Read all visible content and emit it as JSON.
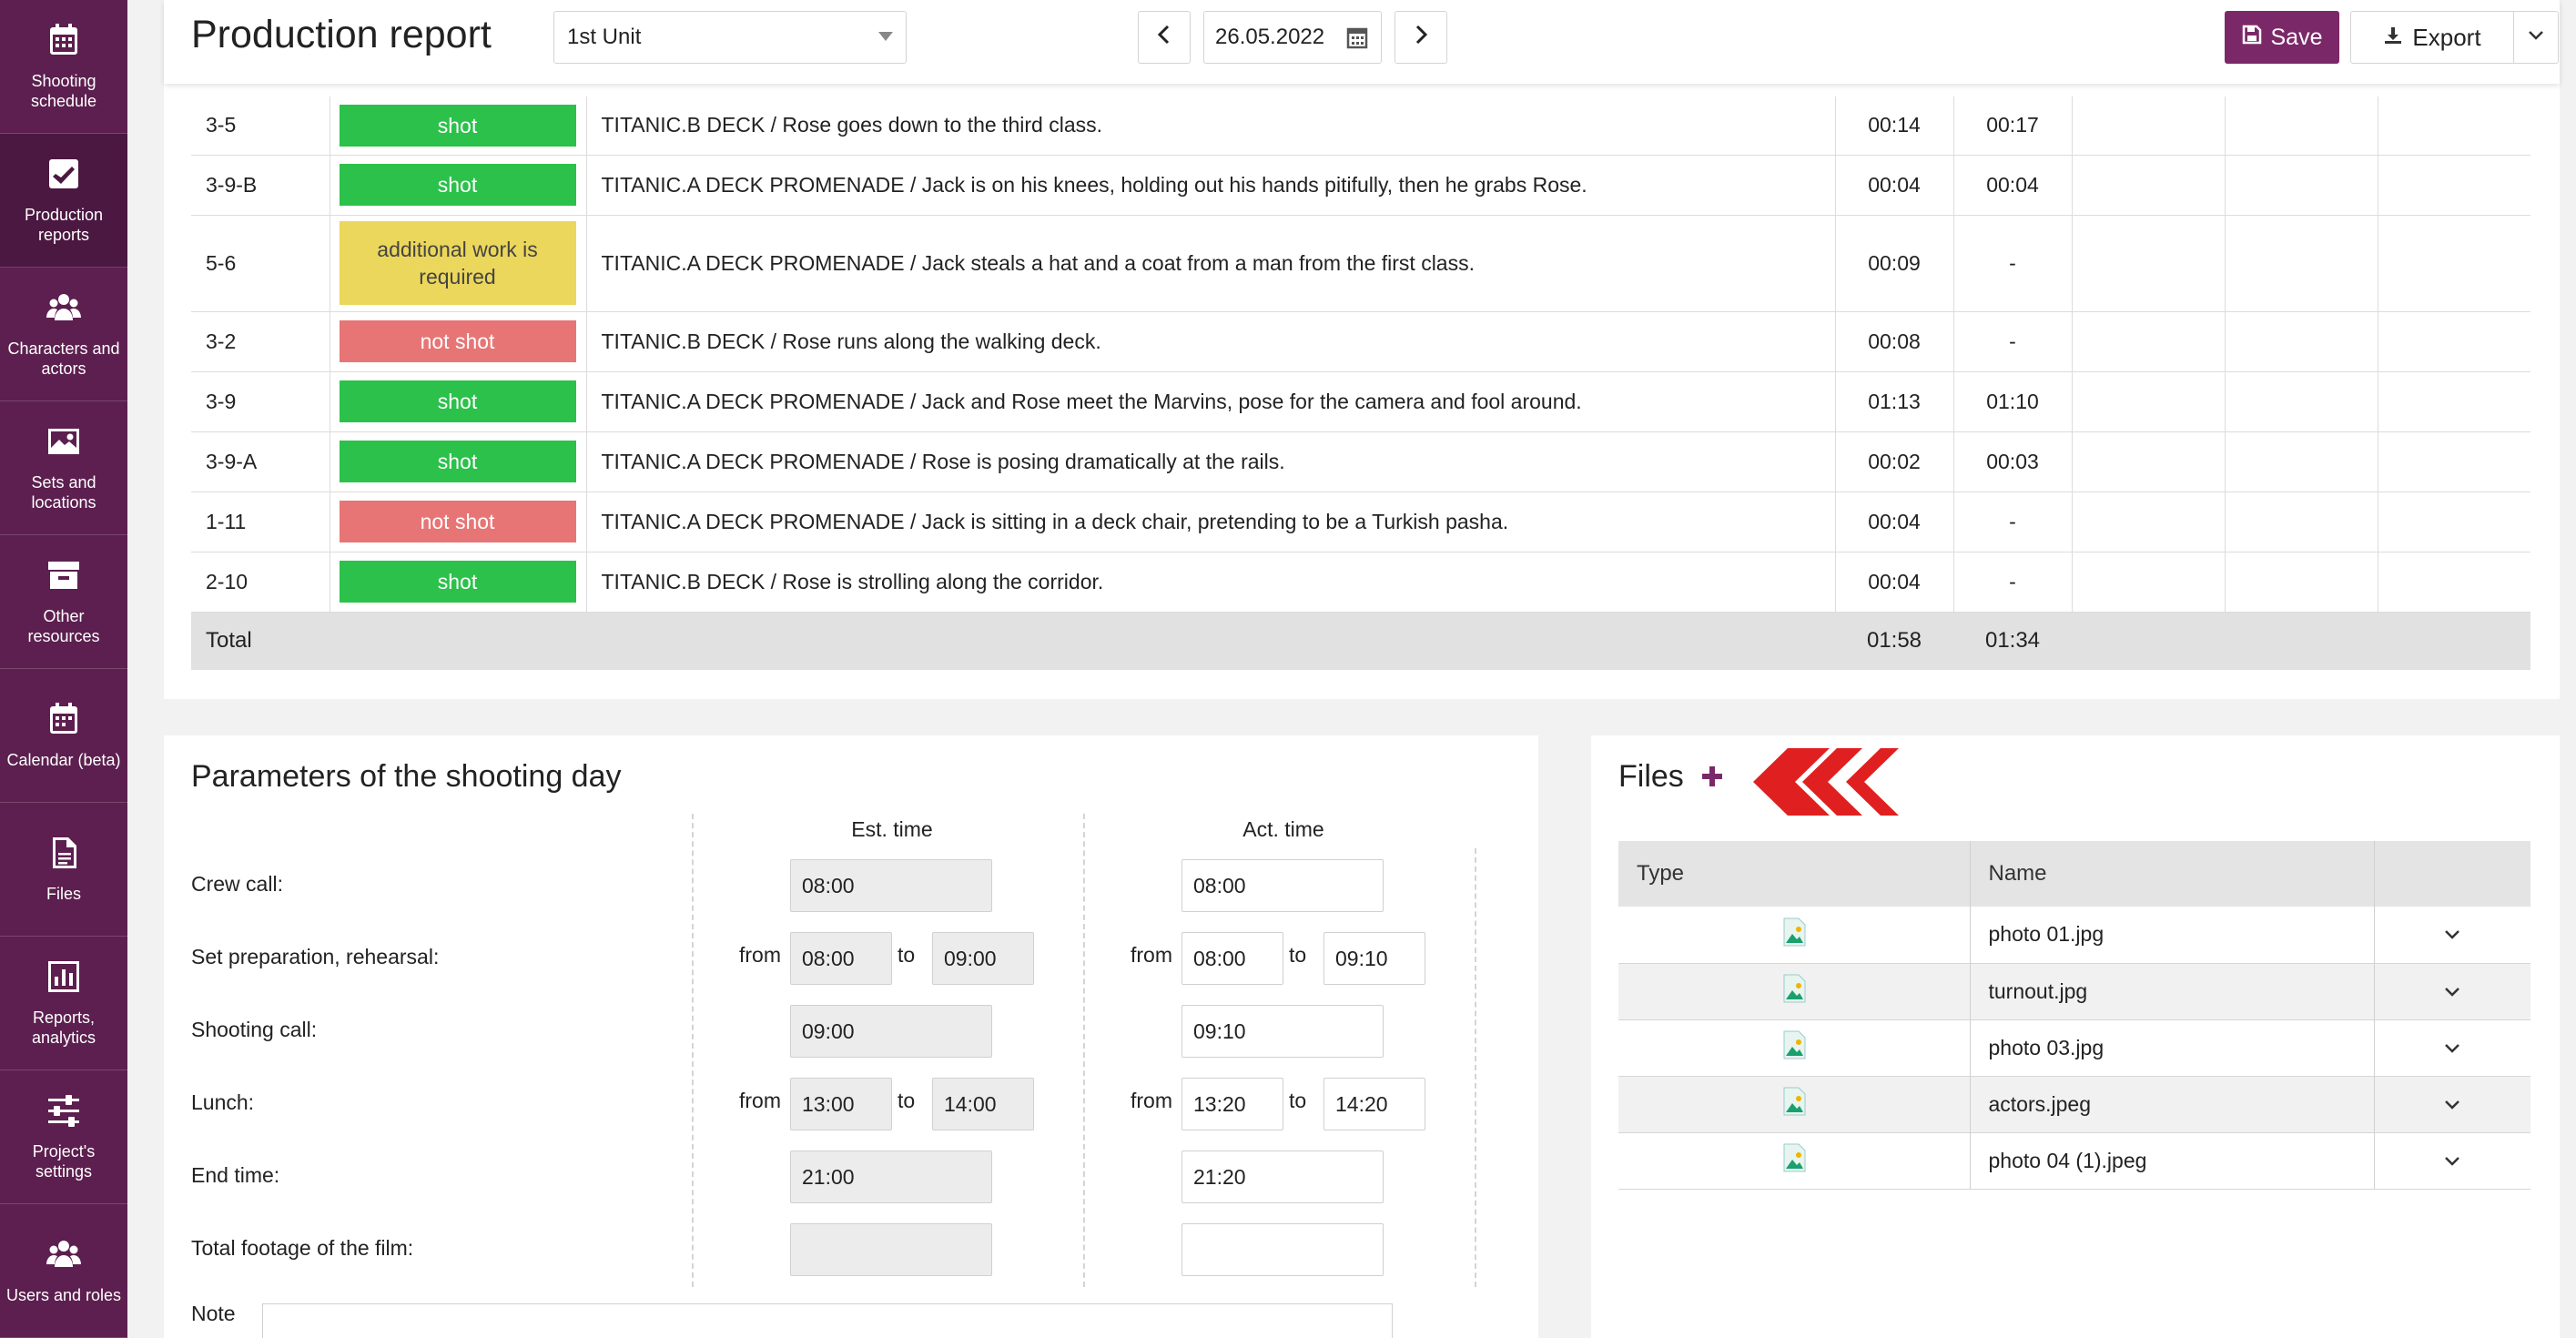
{
  "sidebar": {
    "items": [
      {
        "label": "Shooting schedule",
        "icon": "calendar-grid-icon"
      },
      {
        "label": "Production reports",
        "icon": "checkbox-icon"
      },
      {
        "label": "Characters and actors",
        "icon": "people-icon"
      },
      {
        "label": "Sets and locations",
        "icon": "image-icon"
      },
      {
        "label": "Other resources",
        "icon": "archive-box-icon"
      },
      {
        "label": "Calendar (beta)",
        "icon": "calendar-icon"
      },
      {
        "label": "Files",
        "icon": "document-icon"
      },
      {
        "label": "Reports, analytics",
        "icon": "bar-chart-icon"
      },
      {
        "label": "Project's settings",
        "icon": "sliders-icon"
      },
      {
        "label": "Users and roles",
        "icon": "users-icon"
      }
    ]
  },
  "header": {
    "title": "Production report",
    "unit": "1st Unit",
    "date": "26.05.2022",
    "save_label": "Save",
    "export_label": "Export"
  },
  "scenes": [
    {
      "num": "3-5",
      "status": "shot",
      "kind": "shot",
      "desc": "TITANIC.B DECK / Rose goes down to the third class.",
      "est": "00:14",
      "act": "00:17"
    },
    {
      "num": "3-9-B",
      "status": "shot",
      "kind": "shot",
      "desc": "TITANIC.A DECK PROMENADE / Jack is on his knees, holding out his hands pitifully, then he grabs Rose.",
      "est": "00:04",
      "act": "00:04"
    },
    {
      "num": "5-6",
      "status": "additional work is required",
      "kind": "add",
      "desc": "TITANIC.A DECK PROMENADE / Jack steals a hat and a coat from a man from the first class.",
      "est": "00:09",
      "act": "-"
    },
    {
      "num": "3-2",
      "status": "not shot",
      "kind": "notshot",
      "desc": "TITANIC.B DECK / Rose runs along the walking deck.",
      "est": "00:08",
      "act": "-"
    },
    {
      "num": "3-9",
      "status": "shot",
      "kind": "shot",
      "desc": "TITANIC.A DECK PROMENADE / Jack and Rose meet the Marvins, pose for the camera and fool around.",
      "est": "01:13",
      "act": "01:10"
    },
    {
      "num": "3-9-A",
      "status": "shot",
      "kind": "shot",
      "desc": "TITANIC.A DECK PROMENADE / Rose is posing dramatically at the rails.",
      "est": "00:02",
      "act": "00:03"
    },
    {
      "num": "1-11",
      "status": "not shot",
      "kind": "notshot",
      "desc": "TITANIC.A DECK PROMENADE / Jack is sitting in a deck chair, pretending to be a Turkish pasha.",
      "est": "00:04",
      "act": "-"
    },
    {
      "num": "2-10",
      "status": "shot",
      "kind": "shot",
      "desc": "TITANIC.B DECK / Rose is strolling along the corridor.",
      "est": "00:04",
      "act": "-"
    }
  ],
  "totals": {
    "label": "Total",
    "est": "01:58",
    "act": "01:34"
  },
  "params": {
    "title": "Parameters of the shooting day",
    "est_header": "Est. time",
    "act_header": "Act. time",
    "from_label": "from",
    "to_label": "to",
    "crew_call": {
      "label": "Crew call:",
      "est": "08:00",
      "act": "08:00"
    },
    "set_prep": {
      "label": "Set preparation, rehearsal:",
      "est_from": "08:00",
      "est_to": "09:00",
      "act_from": "08:00",
      "act_to": "09:10"
    },
    "shooting_call": {
      "label": "Shooting call:",
      "est": "09:00",
      "act": "09:10"
    },
    "lunch": {
      "label": "Lunch:",
      "est_from": "13:00",
      "est_to": "14:00",
      "act_from": "13:20",
      "act_to": "14:20"
    },
    "end_time": {
      "label": "End time:",
      "est": "21:00",
      "act": "21:20"
    },
    "footage": {
      "label": "Total footage of the film:",
      "est": "",
      "act": ""
    },
    "note_label": "Note"
  },
  "files": {
    "title": "Files",
    "col_type": "Type",
    "col_name": "Name",
    "items": [
      {
        "name": "photo 01.jpg",
        "icon": "image-file-icon"
      },
      {
        "name": "turnout.jpg",
        "icon": "image-file-icon"
      },
      {
        "name": "photo 03.jpg",
        "icon": "image-file-icon"
      },
      {
        "name": "actors.jpeg",
        "icon": "image-file-icon"
      },
      {
        "name": "photo 04 (1).jpeg",
        "icon": "image-file-icon"
      }
    ]
  },
  "colors": {
    "sidebar": "#5c1f4f",
    "accent": "#7b2869",
    "shot": "#2bc14a",
    "not_shot": "#e87575",
    "additional": "#ebd75b",
    "marker": "#e02020"
  }
}
